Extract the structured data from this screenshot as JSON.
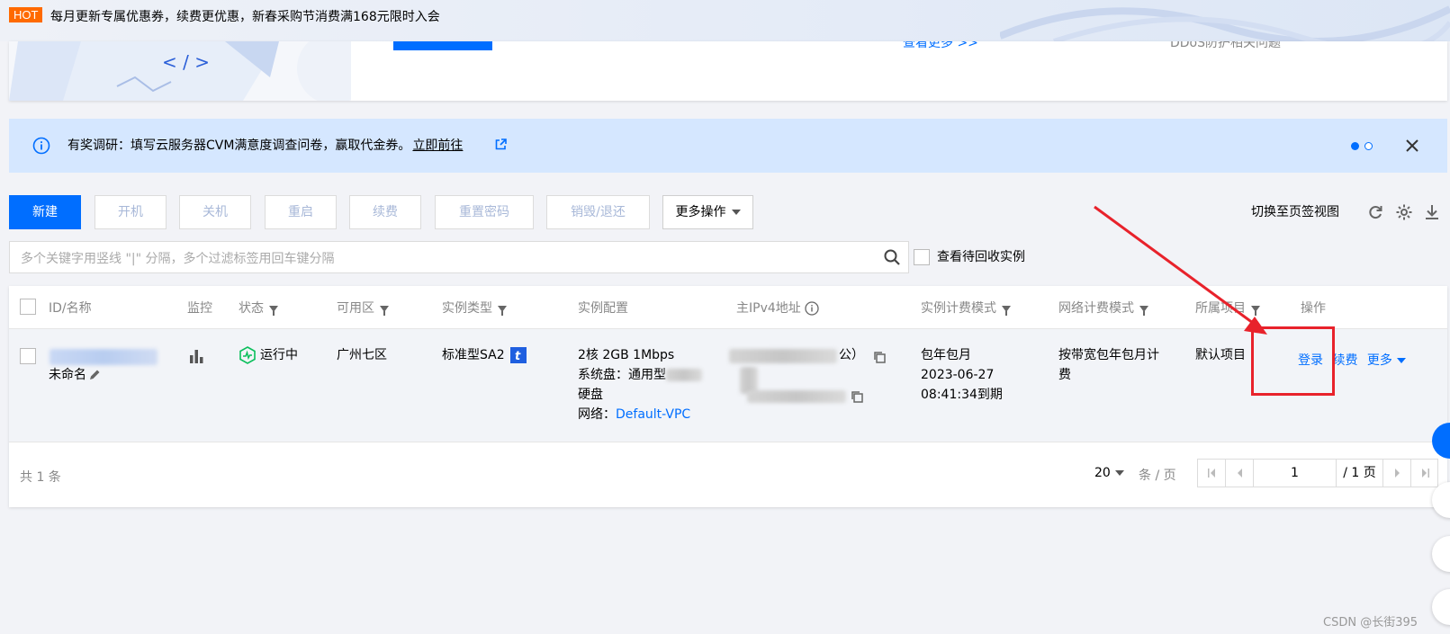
{
  "promo": {
    "badge": "HOT",
    "text": "每月更新专属优惠券，续费更优惠，新春采购节消费满168元限时入会"
  },
  "topcard": {
    "more_link": "查看更多 >>",
    "faq": "DDoS防护相关问题"
  },
  "notice": {
    "text": "有奖调研：填写云服务器CVM满意度调查问卷，赢取代金券。",
    "link": "立即前往"
  },
  "toolbar": {
    "create": "新建",
    "start": "开机",
    "stop": "关机",
    "restart": "重启",
    "renew": "续费",
    "reset_password": "重置密码",
    "destroy": "销毁/退还",
    "more_actions": "更多操作",
    "switch_view": "切换至页签视图"
  },
  "search": {
    "placeholder": "多个关键字用竖线 \"|\" 分隔，多个过滤标签用回车键分隔",
    "recycle_label": "查看待回收实例"
  },
  "table": {
    "headers": {
      "id_name": "ID/名称",
      "monitor": "监控",
      "status": "状态",
      "zone": "可用区",
      "instance_type": "实例类型",
      "config": "实例配置",
      "ipv4": "主IPv4地址",
      "billing": "实例计费模式",
      "network_billing": "网络计费模式",
      "project": "所属项目",
      "actions": "操作"
    },
    "row": {
      "name": "未命名",
      "status": "运行中",
      "zone": "广州七区",
      "instance_type": "标准型SA2",
      "config_line1": "2核 2GB 1Mbps",
      "config_line2": "系统盘：通用型",
      "config_line3": "硬盘",
      "network_label": "网络：",
      "network_value": "Default-VPC",
      "ip_suffix": "公）",
      "billing_line1": "包年包月",
      "billing_line2": "2023-06-27",
      "billing_line3": "08:41:34到期",
      "network_billing_line1": "按带宽包年包月计",
      "network_billing_line2": "费",
      "project": "默认项目",
      "action_login": "登录",
      "action_renew": "续费",
      "action_more": "更多"
    },
    "footer": {
      "total": "共 1 条",
      "page_size": "20",
      "per_page": "条 / 页",
      "current_page": "1",
      "total_pages": "/ 1 页"
    }
  },
  "watermark": "CSDN @长街395",
  "colors": {
    "primary": "#006eff",
    "hot": "#ff6a00",
    "annotation": "#e8222b",
    "running": "#0abf5b"
  }
}
